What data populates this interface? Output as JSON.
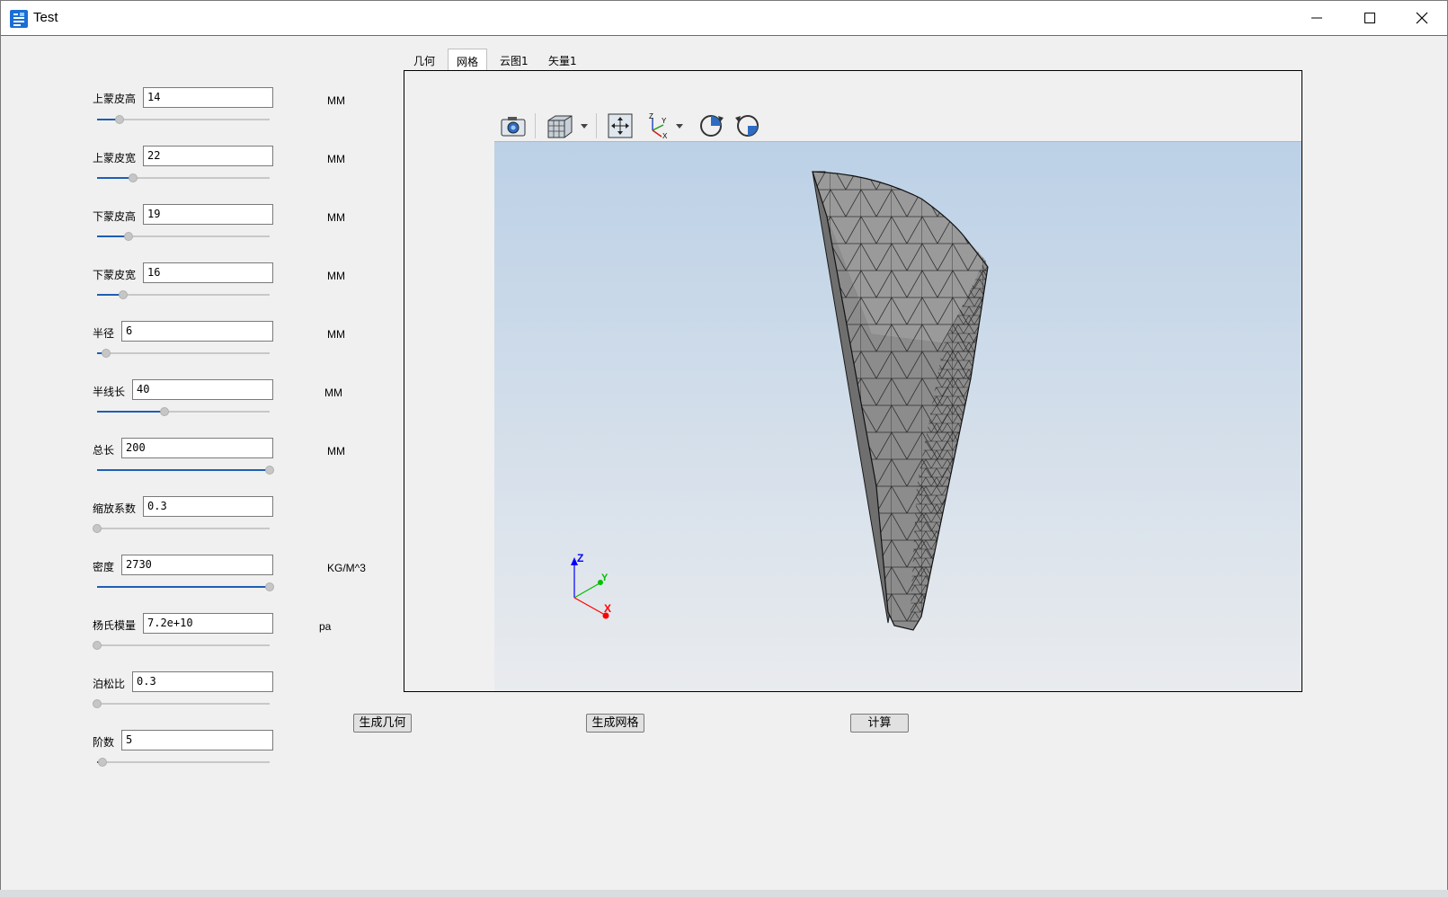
{
  "window": {
    "title": "Test"
  },
  "params": [
    {
      "label": "上蒙皮高",
      "value": "14",
      "unit": "MM",
      "slider": 0.13
    },
    {
      "label": "上蒙皮宽",
      "value": "22",
      "unit": "MM",
      "slider": 0.21
    },
    {
      "label": "下蒙皮高",
      "value": "19",
      "unit": "MM",
      "slider": 0.18
    },
    {
      "label": "下蒙皮宽",
      "value": "16",
      "unit": "MM",
      "slider": 0.15
    },
    {
      "label": "半径",
      "value": "6",
      "unit": "MM",
      "slider": 0.05
    },
    {
      "label": "半线长",
      "value": "40",
      "unit": "MM",
      "slider": 0.39
    },
    {
      "label": "总长",
      "value": "200",
      "unit": "MM",
      "slider": 1.0
    },
    {
      "label": "缩放系数",
      "value": "0.3",
      "unit": "",
      "slider": 0.0
    },
    {
      "label": "密度",
      "value": "2730",
      "unit": "KG/M^3",
      "slider": 1.0
    },
    {
      "label": "杨氏模量",
      "value": "7.2e+10",
      "unit": "pa",
      "slider": 0.0
    },
    {
      "label": "泊松比",
      "value": "0.3",
      "unit": "",
      "slider": 0.0
    },
    {
      "label": "阶数",
      "value": "5",
      "unit": "",
      "slider": 0.03
    }
  ],
  "tabs": [
    {
      "label": "几何",
      "active": false
    },
    {
      "label": "网格",
      "active": true
    },
    {
      "label": "云图1",
      "active": false
    },
    {
      "label": "矢量1",
      "active": false
    }
  ],
  "viewer": {
    "toolbar": [
      "camera-icon",
      "view-cube-icon",
      "fit-view-icon",
      "axis-orientation-icon",
      "rotate-clockwise-icon",
      "rotate-counterclockwise-icon"
    ],
    "axes": {
      "z": "Z",
      "y": "Y",
      "x": "X"
    },
    "colors": {
      "z": "#0000ff",
      "y": "#00c000",
      "x": "#ff0000",
      "mesh_fill": "#8c8c8c"
    }
  },
  "buttons": {
    "geometry": "生成几何",
    "mesh": "生成网格",
    "compute": "计算"
  }
}
